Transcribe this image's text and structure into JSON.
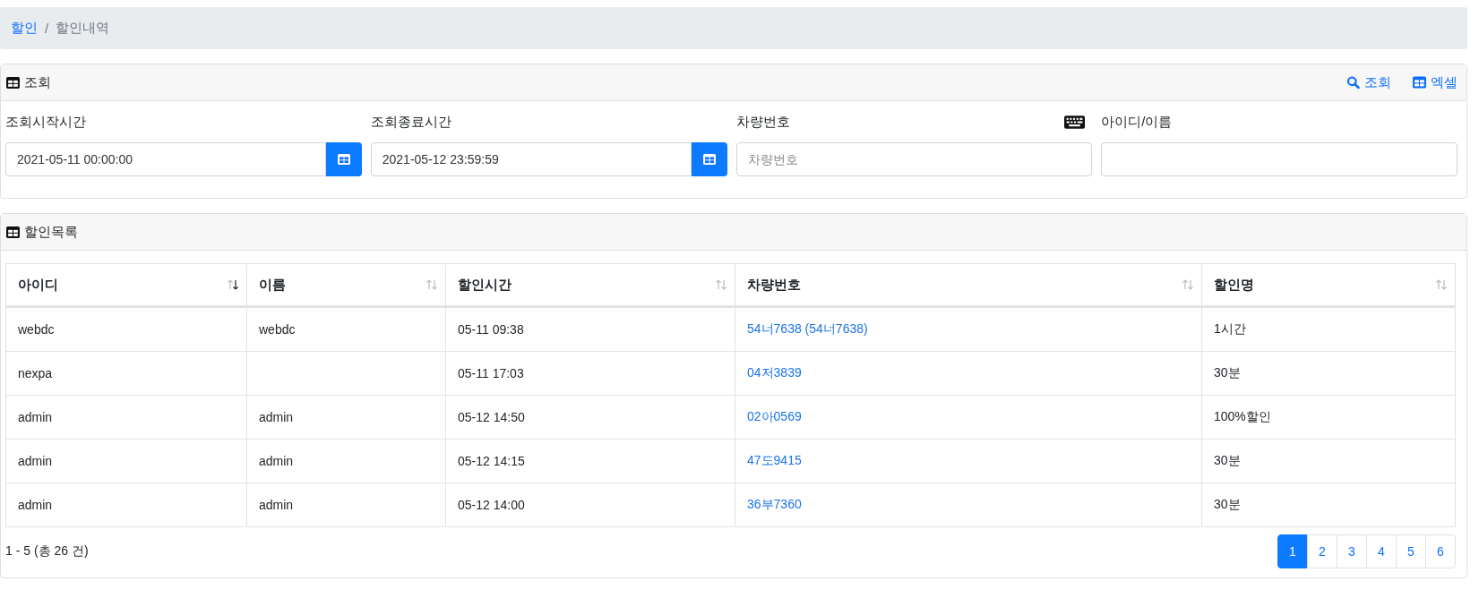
{
  "breadcrumb": [
    {
      "label": "할인",
      "link": true
    },
    {
      "label": "할인내역",
      "link": false
    }
  ],
  "breadcrumb_separator": "/",
  "search_card": {
    "title": "조회",
    "actions": [
      {
        "label": "조회",
        "kind": "search"
      },
      {
        "label": "엑셀",
        "kind": "table"
      }
    ],
    "fields": [
      {
        "label": "조회시작시간",
        "value": "2021-05-11 00:00:00",
        "kind": "date"
      },
      {
        "label": "조회종료시간",
        "value": "2021-05-12 23:59:59",
        "kind": "date"
      },
      {
        "label": "차량번호",
        "placeholder": "차량번호",
        "kind": "keyboard"
      },
      {
        "label": "아이디/이름",
        "kind": "text"
      }
    ]
  },
  "list_card": {
    "title": "할인목록",
    "columns": [
      {
        "label": "아이디",
        "sorted": true
      },
      {
        "label": "이름",
        "sorted": false
      },
      {
        "label": "할인시간",
        "sorted": false
      },
      {
        "label": "차량번호",
        "sorted": false
      },
      {
        "label": "할인명",
        "sorted": false
      }
    ],
    "rows": [
      [
        "webdc",
        "webdc",
        "05-11 09:38",
        "54너7638 (54너7638)",
        "1시간"
      ],
      [
        "nexpa",
        "",
        "05-11 17:03",
        "04저3839",
        "30분"
      ],
      [
        "admin",
        "admin",
        "05-12 14:50",
        "02아0569",
        "100%할인"
      ],
      [
        "admin",
        "admin",
        "05-12 14:15",
        "47도9415",
        "30분"
      ],
      [
        "admin",
        "admin",
        "05-12 14:00",
        "36부7360",
        "30분"
      ]
    ],
    "summary": "1 - 5 (총 26 건)",
    "pages": [
      {
        "label": "1",
        "selected": true
      },
      {
        "label": "2",
        "selected": false
      },
      {
        "label": "3",
        "selected": false
      },
      {
        "label": "4",
        "selected": false
      },
      {
        "label": "5",
        "selected": false
      },
      {
        "label": "6",
        "selected": false
      }
    ]
  }
}
